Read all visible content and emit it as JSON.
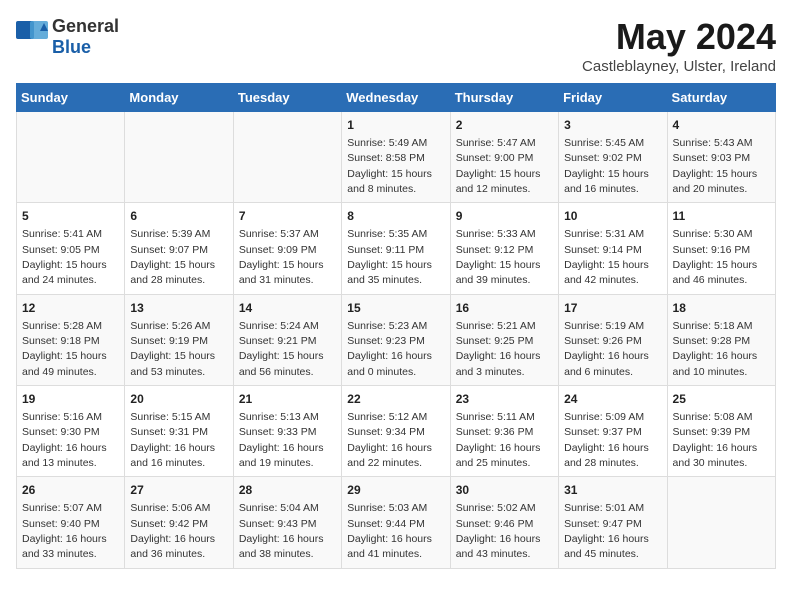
{
  "logo": {
    "general": "General",
    "blue": "Blue"
  },
  "title": "May 2024",
  "location": "Castleblayney, Ulster, Ireland",
  "headers": [
    "Sunday",
    "Monday",
    "Tuesday",
    "Wednesday",
    "Thursday",
    "Friday",
    "Saturday"
  ],
  "weeks": [
    [
      {
        "day": "",
        "sunrise": "",
        "sunset": "",
        "daylight": ""
      },
      {
        "day": "",
        "sunrise": "",
        "sunset": "",
        "daylight": ""
      },
      {
        "day": "",
        "sunrise": "",
        "sunset": "",
        "daylight": ""
      },
      {
        "day": "1",
        "sunrise": "Sunrise: 5:49 AM",
        "sunset": "Sunset: 8:58 PM",
        "daylight": "Daylight: 15 hours and 8 minutes."
      },
      {
        "day": "2",
        "sunrise": "Sunrise: 5:47 AM",
        "sunset": "Sunset: 9:00 PM",
        "daylight": "Daylight: 15 hours and 12 minutes."
      },
      {
        "day": "3",
        "sunrise": "Sunrise: 5:45 AM",
        "sunset": "Sunset: 9:02 PM",
        "daylight": "Daylight: 15 hours and 16 minutes."
      },
      {
        "day": "4",
        "sunrise": "Sunrise: 5:43 AM",
        "sunset": "Sunset: 9:03 PM",
        "daylight": "Daylight: 15 hours and 20 minutes."
      }
    ],
    [
      {
        "day": "5",
        "sunrise": "Sunrise: 5:41 AM",
        "sunset": "Sunset: 9:05 PM",
        "daylight": "Daylight: 15 hours and 24 minutes."
      },
      {
        "day": "6",
        "sunrise": "Sunrise: 5:39 AM",
        "sunset": "Sunset: 9:07 PM",
        "daylight": "Daylight: 15 hours and 28 minutes."
      },
      {
        "day": "7",
        "sunrise": "Sunrise: 5:37 AM",
        "sunset": "Sunset: 9:09 PM",
        "daylight": "Daylight: 15 hours and 31 minutes."
      },
      {
        "day": "8",
        "sunrise": "Sunrise: 5:35 AM",
        "sunset": "Sunset: 9:11 PM",
        "daylight": "Daylight: 15 hours and 35 minutes."
      },
      {
        "day": "9",
        "sunrise": "Sunrise: 5:33 AM",
        "sunset": "Sunset: 9:12 PM",
        "daylight": "Daylight: 15 hours and 39 minutes."
      },
      {
        "day": "10",
        "sunrise": "Sunrise: 5:31 AM",
        "sunset": "Sunset: 9:14 PM",
        "daylight": "Daylight: 15 hours and 42 minutes."
      },
      {
        "day": "11",
        "sunrise": "Sunrise: 5:30 AM",
        "sunset": "Sunset: 9:16 PM",
        "daylight": "Daylight: 15 hours and 46 minutes."
      }
    ],
    [
      {
        "day": "12",
        "sunrise": "Sunrise: 5:28 AM",
        "sunset": "Sunset: 9:18 PM",
        "daylight": "Daylight: 15 hours and 49 minutes."
      },
      {
        "day": "13",
        "sunrise": "Sunrise: 5:26 AM",
        "sunset": "Sunset: 9:19 PM",
        "daylight": "Daylight: 15 hours and 53 minutes."
      },
      {
        "day": "14",
        "sunrise": "Sunrise: 5:24 AM",
        "sunset": "Sunset: 9:21 PM",
        "daylight": "Daylight: 15 hours and 56 minutes."
      },
      {
        "day": "15",
        "sunrise": "Sunrise: 5:23 AM",
        "sunset": "Sunset: 9:23 PM",
        "daylight": "Daylight: 16 hours and 0 minutes."
      },
      {
        "day": "16",
        "sunrise": "Sunrise: 5:21 AM",
        "sunset": "Sunset: 9:25 PM",
        "daylight": "Daylight: 16 hours and 3 minutes."
      },
      {
        "day": "17",
        "sunrise": "Sunrise: 5:19 AM",
        "sunset": "Sunset: 9:26 PM",
        "daylight": "Daylight: 16 hours and 6 minutes."
      },
      {
        "day": "18",
        "sunrise": "Sunrise: 5:18 AM",
        "sunset": "Sunset: 9:28 PM",
        "daylight": "Daylight: 16 hours and 10 minutes."
      }
    ],
    [
      {
        "day": "19",
        "sunrise": "Sunrise: 5:16 AM",
        "sunset": "Sunset: 9:30 PM",
        "daylight": "Daylight: 16 hours and 13 minutes."
      },
      {
        "day": "20",
        "sunrise": "Sunrise: 5:15 AM",
        "sunset": "Sunset: 9:31 PM",
        "daylight": "Daylight: 16 hours and 16 minutes."
      },
      {
        "day": "21",
        "sunrise": "Sunrise: 5:13 AM",
        "sunset": "Sunset: 9:33 PM",
        "daylight": "Daylight: 16 hours and 19 minutes."
      },
      {
        "day": "22",
        "sunrise": "Sunrise: 5:12 AM",
        "sunset": "Sunset: 9:34 PM",
        "daylight": "Daylight: 16 hours and 22 minutes."
      },
      {
        "day": "23",
        "sunrise": "Sunrise: 5:11 AM",
        "sunset": "Sunset: 9:36 PM",
        "daylight": "Daylight: 16 hours and 25 minutes."
      },
      {
        "day": "24",
        "sunrise": "Sunrise: 5:09 AM",
        "sunset": "Sunset: 9:37 PM",
        "daylight": "Daylight: 16 hours and 28 minutes."
      },
      {
        "day": "25",
        "sunrise": "Sunrise: 5:08 AM",
        "sunset": "Sunset: 9:39 PM",
        "daylight": "Daylight: 16 hours and 30 minutes."
      }
    ],
    [
      {
        "day": "26",
        "sunrise": "Sunrise: 5:07 AM",
        "sunset": "Sunset: 9:40 PM",
        "daylight": "Daylight: 16 hours and 33 minutes."
      },
      {
        "day": "27",
        "sunrise": "Sunrise: 5:06 AM",
        "sunset": "Sunset: 9:42 PM",
        "daylight": "Daylight: 16 hours and 36 minutes."
      },
      {
        "day": "28",
        "sunrise": "Sunrise: 5:04 AM",
        "sunset": "Sunset: 9:43 PM",
        "daylight": "Daylight: 16 hours and 38 minutes."
      },
      {
        "day": "29",
        "sunrise": "Sunrise: 5:03 AM",
        "sunset": "Sunset: 9:44 PM",
        "daylight": "Daylight: 16 hours and 41 minutes."
      },
      {
        "day": "30",
        "sunrise": "Sunrise: 5:02 AM",
        "sunset": "Sunset: 9:46 PM",
        "daylight": "Daylight: 16 hours and 43 minutes."
      },
      {
        "day": "31",
        "sunrise": "Sunrise: 5:01 AM",
        "sunset": "Sunset: 9:47 PM",
        "daylight": "Daylight: 16 hours and 45 minutes."
      },
      {
        "day": "",
        "sunrise": "",
        "sunset": "",
        "daylight": ""
      }
    ]
  ]
}
